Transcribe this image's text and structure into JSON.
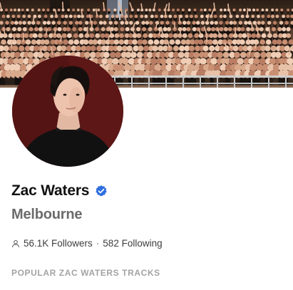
{
  "profile": {
    "name": "Zac Waters",
    "location": "Melbourne",
    "followers_label": "56.1K Followers",
    "separator": "·",
    "following_label": "582 Following",
    "verified": true
  },
  "sections": {
    "popular_tracks_heading": "POPULAR ZAC WATERS TRACKS"
  },
  "colors": {
    "verified_badge": "#2f6fdf",
    "name_text": "#111111",
    "location_text": "#6b6b6b",
    "heading_text": "#a3a3a3",
    "avatar_background": "#5a1514"
  },
  "icons": {
    "verified": "verified-badge-icon",
    "followers": "person-icon"
  }
}
